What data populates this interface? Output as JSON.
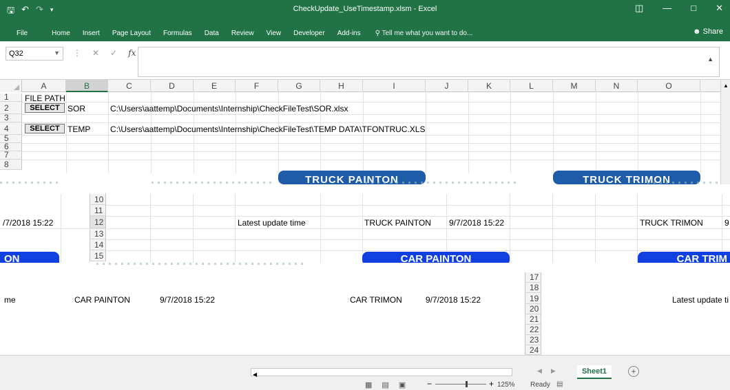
{
  "window": {
    "title": "CheckUpdate_UseTimestamp.xlsm - Excel",
    "save_icon": "save-icon",
    "undo_icon": "undo-icon",
    "redo_icon": "redo-icon"
  },
  "ribbon": {
    "tabs": [
      "File",
      "Home",
      "Insert",
      "Page Layout",
      "Formulas",
      "Data",
      "Review",
      "View",
      "Developer",
      "Add-ins"
    ],
    "tell_me": "Tell me what you want to do...",
    "share": "Share"
  },
  "formula_bar": {
    "name_box": "Q32",
    "fx": "fx",
    "value": ""
  },
  "columns": [
    "A",
    "B",
    "C",
    "D",
    "E",
    "F",
    "G",
    "H",
    "I",
    "J",
    "K",
    "L",
    "M",
    "N",
    "O"
  ],
  "rows_top": [
    "1",
    "2",
    "3",
    "4",
    "5",
    "6",
    "7",
    "8"
  ],
  "rows_mid": [
    "10",
    "11",
    "12",
    "13",
    "14",
    "15"
  ],
  "rows_right": [
    "17",
    "18",
    "19",
    "20",
    "21",
    "22",
    "23",
    "24"
  ],
  "cells": {
    "a1": "FILE PATH",
    "b2": "SOR",
    "c2": "C:\\Users\\aattemp\\Documents\\Internship\\CheckFileTest\\SOR.xlsx",
    "b4": "TEMP",
    "c4": "C:\\Users\\aattemp\\Documents\\Internship\\CheckFileTest\\TEMP DATA\\TFONTRUC.XLS",
    "select_label": "SELECT",
    "ts_left": "/7/2018 15:22",
    "latest_update": "Latest update time",
    "truck_painton": "TRUCK PAINTON",
    "truck_painton_ts": "9/7/2018 15:22",
    "truck_trimon": "TRUCK TRIMON",
    "truck_trimon_ts": "9",
    "me_frag": "me",
    "car_painton": "CAR PAINTON",
    "car_painton_ts": "9/7/2018 15:22",
    "car_trimon": "CAR TRIMON",
    "car_trimon_ts": "9/7/2018 15:22",
    "latest_update_frag": "Latest update ti"
  },
  "buttons": {
    "truck_painton_btn": "TRUCK PAINTON",
    "truck_trimon_btn": "TRUCK TRIMON",
    "car_painton_btn": "CAR PAINTON",
    "car_trim_btn": "CAR TRIM",
    "left_frag_btn": "ON"
  },
  "status": {
    "ready": "Ready",
    "zoom": "125%",
    "sheet_tab": "Sheet1"
  }
}
